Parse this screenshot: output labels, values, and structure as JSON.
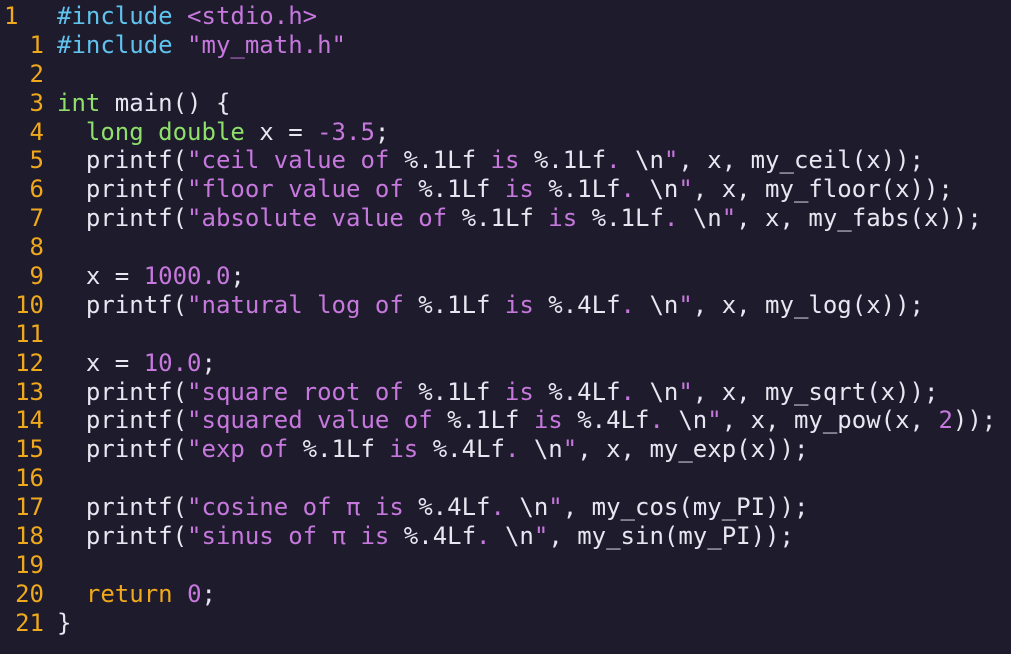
{
  "editor": {
    "colors": {
      "background": "#1e1b2d",
      "line_number": "#f0a81c",
      "preprocessor": "#5fc3ee",
      "string": "#c678dd",
      "type": "#8fe06a",
      "keyword": "#f0a81c",
      "number": "#c678dd",
      "plain": "#e8e6f0"
    },
    "lines": [
      {
        "num": "1",
        "current": true,
        "tokens": [
          [
            "pre",
            "#include "
          ],
          [
            "str",
            "<stdio.h>"
          ]
        ]
      },
      {
        "num": "1",
        "tokens": [
          [
            "pre",
            "#include "
          ],
          [
            "str",
            "\"my_math.h\""
          ]
        ]
      },
      {
        "num": "2",
        "tokens": []
      },
      {
        "num": "3",
        "tokens": [
          [
            "type",
            "int"
          ],
          [
            "plain",
            " main() {"
          ]
        ]
      },
      {
        "num": "4",
        "tokens": [
          [
            "plain",
            "  "
          ],
          [
            "type",
            "long double"
          ],
          [
            "plain",
            " x = "
          ],
          [
            "num",
            "-3.5"
          ],
          [
            "plain",
            ";"
          ]
        ]
      },
      {
        "num": "5",
        "tokens": [
          [
            "plain",
            "  printf("
          ],
          [
            "str",
            "\"ceil value of "
          ],
          [
            "fmt",
            "%.1Lf"
          ],
          [
            "str",
            " is "
          ],
          [
            "fmt",
            "%.1Lf"
          ],
          [
            "str",
            ". "
          ],
          [
            "fmt",
            "\\n"
          ],
          [
            "str",
            "\""
          ],
          [
            "plain",
            ", x, my_ceil(x));"
          ]
        ]
      },
      {
        "num": "6",
        "tokens": [
          [
            "plain",
            "  printf("
          ],
          [
            "str",
            "\"floor value of "
          ],
          [
            "fmt",
            "%.1Lf"
          ],
          [
            "str",
            " is "
          ],
          [
            "fmt",
            "%.1Lf"
          ],
          [
            "str",
            ". "
          ],
          [
            "fmt",
            "\\n"
          ],
          [
            "str",
            "\""
          ],
          [
            "plain",
            ", x, my_floor(x));"
          ]
        ]
      },
      {
        "num": "7",
        "tokens": [
          [
            "plain",
            "  printf("
          ],
          [
            "str",
            "\"absolute value of "
          ],
          [
            "fmt",
            "%.1Lf"
          ],
          [
            "str",
            " is "
          ],
          [
            "fmt",
            "%.1Lf"
          ],
          [
            "str",
            ". "
          ],
          [
            "fmt",
            "\\n"
          ],
          [
            "str",
            "\""
          ],
          [
            "plain",
            ", x, my_fabs(x));"
          ]
        ]
      },
      {
        "num": "8",
        "tokens": []
      },
      {
        "num": "9",
        "tokens": [
          [
            "plain",
            "  x = "
          ],
          [
            "num",
            "1000.0"
          ],
          [
            "plain",
            ";"
          ]
        ]
      },
      {
        "num": "10",
        "tokens": [
          [
            "plain",
            "  printf("
          ],
          [
            "str",
            "\"natural log of "
          ],
          [
            "fmt",
            "%.1Lf"
          ],
          [
            "str",
            " is "
          ],
          [
            "fmt",
            "%.4Lf"
          ],
          [
            "str",
            ". "
          ],
          [
            "fmt",
            "\\n"
          ],
          [
            "str",
            "\""
          ],
          [
            "plain",
            ", x, my_log(x));"
          ]
        ]
      },
      {
        "num": "11",
        "tokens": []
      },
      {
        "num": "12",
        "tokens": [
          [
            "plain",
            "  x = "
          ],
          [
            "num",
            "10.0"
          ],
          [
            "plain",
            ";"
          ]
        ]
      },
      {
        "num": "13",
        "tokens": [
          [
            "plain",
            "  printf("
          ],
          [
            "str",
            "\"square root of "
          ],
          [
            "fmt",
            "%.1Lf"
          ],
          [
            "str",
            " is "
          ],
          [
            "fmt",
            "%.4Lf"
          ],
          [
            "str",
            ". "
          ],
          [
            "fmt",
            "\\n"
          ],
          [
            "str",
            "\""
          ],
          [
            "plain",
            ", x, my_sqrt(x));"
          ]
        ]
      },
      {
        "num": "14",
        "tokens": [
          [
            "plain",
            "  printf("
          ],
          [
            "str",
            "\"squared value of "
          ],
          [
            "fmt",
            "%.1Lf"
          ],
          [
            "str",
            " is "
          ],
          [
            "fmt",
            "%.4Lf"
          ],
          [
            "str",
            ". "
          ],
          [
            "fmt",
            "\\n"
          ],
          [
            "str",
            "\""
          ],
          [
            "plain",
            ", x, my_pow(x, "
          ],
          [
            "num",
            "2"
          ],
          [
            "plain",
            "));"
          ]
        ]
      },
      {
        "num": "15",
        "tokens": [
          [
            "plain",
            "  printf("
          ],
          [
            "str",
            "\"exp of "
          ],
          [
            "fmt",
            "%.1Lf"
          ],
          [
            "str",
            " is "
          ],
          [
            "fmt",
            "%.4Lf"
          ],
          [
            "str",
            ". "
          ],
          [
            "fmt",
            "\\n"
          ],
          [
            "str",
            "\""
          ],
          [
            "plain",
            ", x, my_exp(x));"
          ]
        ]
      },
      {
        "num": "16",
        "tokens": []
      },
      {
        "num": "17",
        "tokens": [
          [
            "plain",
            "  printf("
          ],
          [
            "str",
            "\"cosine of π is "
          ],
          [
            "fmt",
            "%.4Lf"
          ],
          [
            "str",
            ". "
          ],
          [
            "fmt",
            "\\n"
          ],
          [
            "str",
            "\""
          ],
          [
            "plain",
            ", my_cos(my_PI));"
          ]
        ]
      },
      {
        "num": "18",
        "tokens": [
          [
            "plain",
            "  printf("
          ],
          [
            "str",
            "\"sinus of π is "
          ],
          [
            "fmt",
            "%.4Lf"
          ],
          [
            "str",
            ". "
          ],
          [
            "fmt",
            "\\n"
          ],
          [
            "str",
            "\""
          ],
          [
            "plain",
            ", my_sin(my_PI));"
          ]
        ]
      },
      {
        "num": "19",
        "tokens": []
      },
      {
        "num": "20",
        "tokens": [
          [
            "plain",
            "  "
          ],
          [
            "kw",
            "return"
          ],
          [
            "plain",
            " "
          ],
          [
            "num",
            "0"
          ],
          [
            "plain",
            ";"
          ]
        ]
      },
      {
        "num": "21",
        "tokens": [
          [
            "plain",
            "}"
          ]
        ]
      }
    ]
  }
}
